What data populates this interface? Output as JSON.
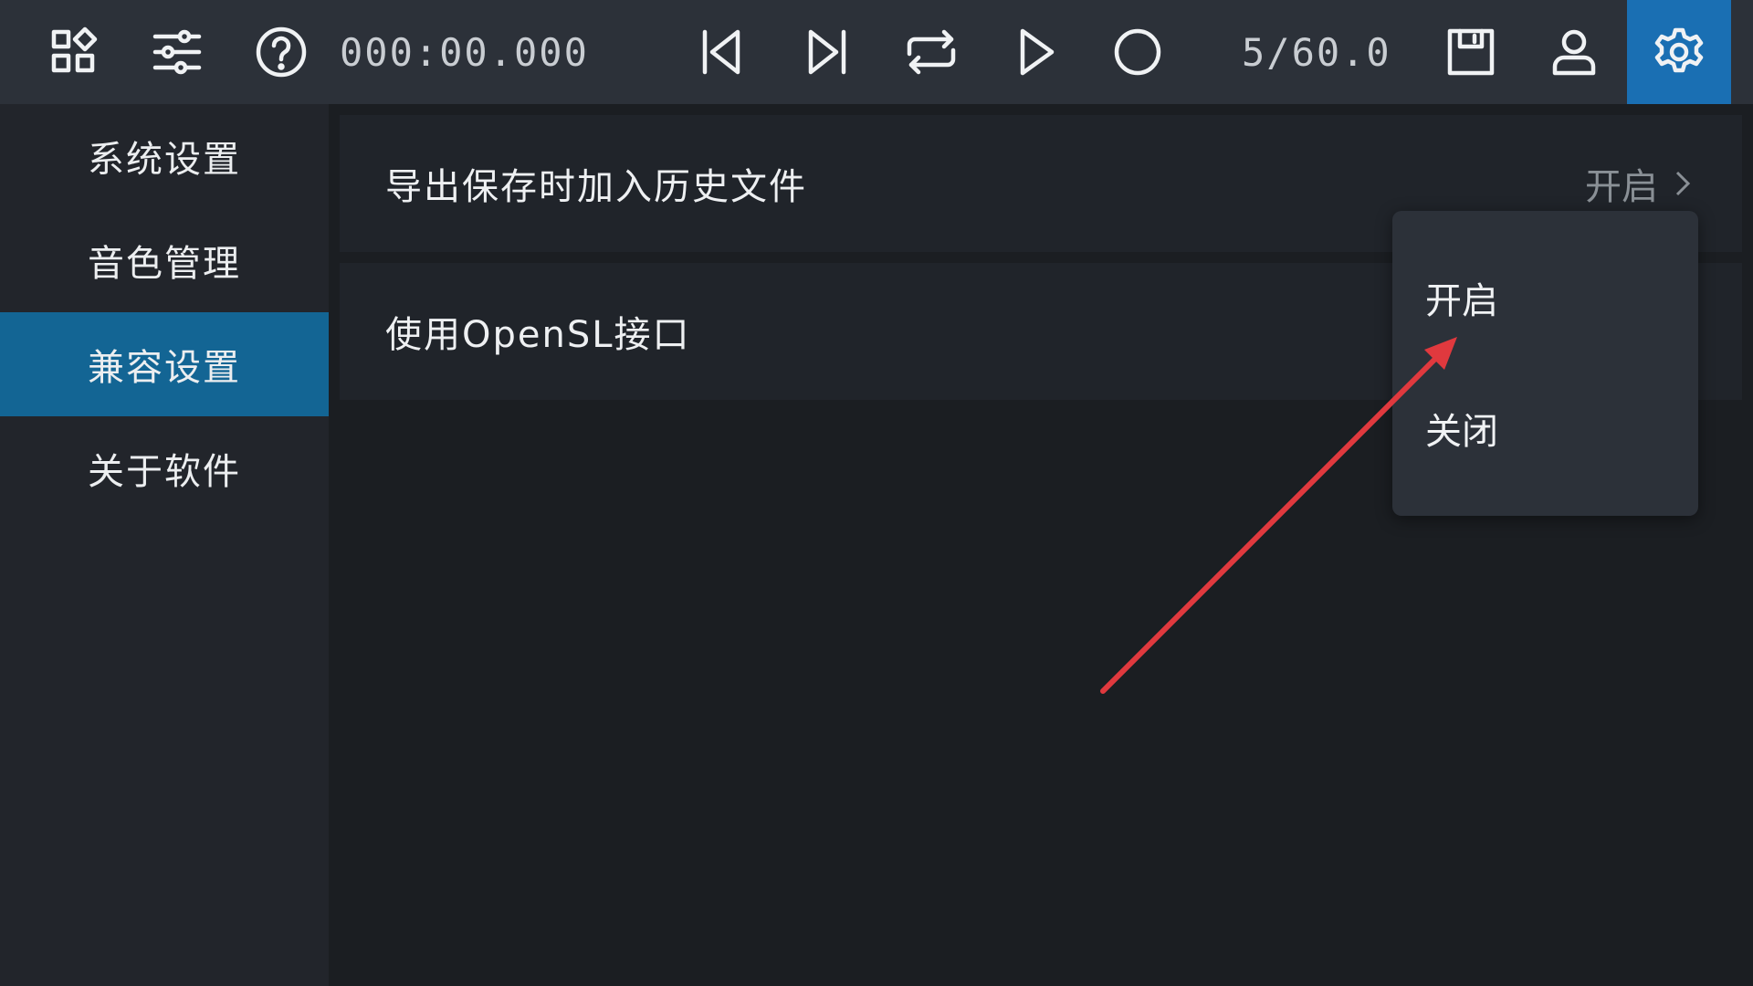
{
  "toolbar": {
    "time": "000:00.000",
    "counter": "5/60.0",
    "icons": [
      "apps-icon",
      "sliders-icon",
      "help-icon",
      "skip-start-icon",
      "skip-end-icon",
      "repeat-icon",
      "play-icon",
      "record-icon",
      "save-icon",
      "user-icon",
      "settings-icon"
    ],
    "active_color": "#1a6fb3"
  },
  "sidebar": {
    "items": [
      {
        "label": "系统设置"
      },
      {
        "label": "音色管理"
      },
      {
        "label": "兼容设置"
      },
      {
        "label": "关于软件"
      }
    ],
    "selected_index": 2,
    "selected_color": "#136594"
  },
  "settings": {
    "rows": [
      {
        "label": "导出保存时加入历史文件",
        "value": "开启"
      },
      {
        "label": "使用OpenSL接口",
        "value": ""
      }
    ]
  },
  "dropdown": {
    "options": [
      {
        "label": "开启"
      },
      {
        "label": "关闭"
      }
    ]
  },
  "annotation": {
    "arrow_color": "#e0393e"
  }
}
